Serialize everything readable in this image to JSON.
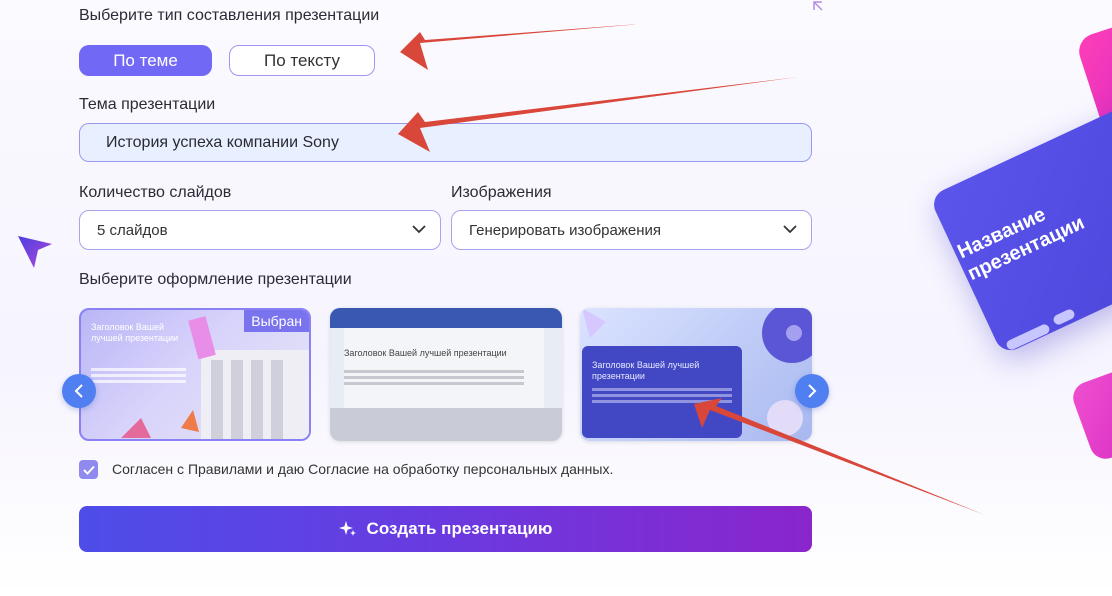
{
  "composition": {
    "heading": "Выберите тип составления презентации",
    "options": [
      "По теме",
      "По тексту"
    ],
    "selected": "По теме"
  },
  "topic": {
    "label": "Тема презентации",
    "value": "История успеха компании Sony"
  },
  "slides": {
    "label": "Количество слайдов",
    "value": "5 слайдов"
  },
  "images": {
    "label": "Изображения",
    "value": "Генерировать изображения"
  },
  "design": {
    "heading": "Выберите оформление презентации",
    "selected_badge": "Выбран",
    "themes": [
      {
        "title": "Заголовок Вашей лучшей презентации"
      },
      {
        "title": "Заголовок Вашей лучшей презентации"
      },
      {
        "title": "Заголовок Вашей лучшей презентации"
      }
    ]
  },
  "consent": {
    "checked": true,
    "text": "Согласен с Правилами и даю Согласие на обработку персональных данных."
  },
  "create_button": {
    "label": "Создать презентацию"
  },
  "decor": {
    "card_title": "Название презентации"
  },
  "colors": {
    "accent": "#7168f5",
    "button_start": "#4d4de8",
    "button_end": "#8a25cc",
    "annotation_arrow": "#d9463a"
  }
}
